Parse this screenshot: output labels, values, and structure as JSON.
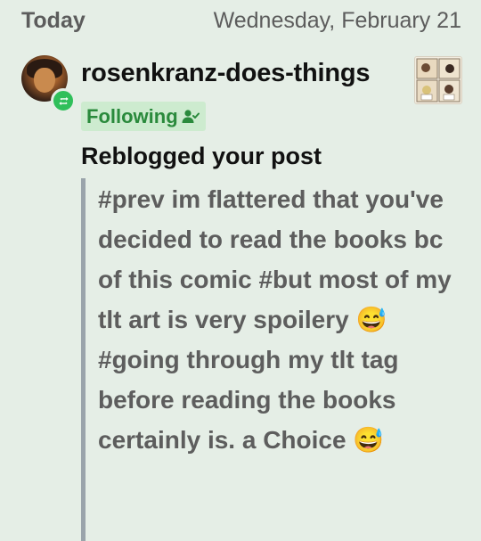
{
  "header": {
    "today": "Today",
    "date": "Wednesday, February 21"
  },
  "notification": {
    "username": "rosenkranz-does-things",
    "follow_label": "Following",
    "action": "Reblogged your post",
    "quote_text": "#prev im flattered that you've decided to read the books bc of this comic #but most of my tlt art is very spoilery 😅 #going through my tlt tag before reading the books certainly is. a Choice 😅",
    "badge_icon": "reblog-icon",
    "follow_icon": "user-check-icon",
    "colors": {
      "background": "#e5eee6",
      "follow_chip_bg": "#cdebcf",
      "follow_text": "#2a8a3c",
      "badge": "#2fbf5a",
      "quote_bar": "#9aa4ab",
      "quote_text": "#5d5d5d"
    }
  }
}
